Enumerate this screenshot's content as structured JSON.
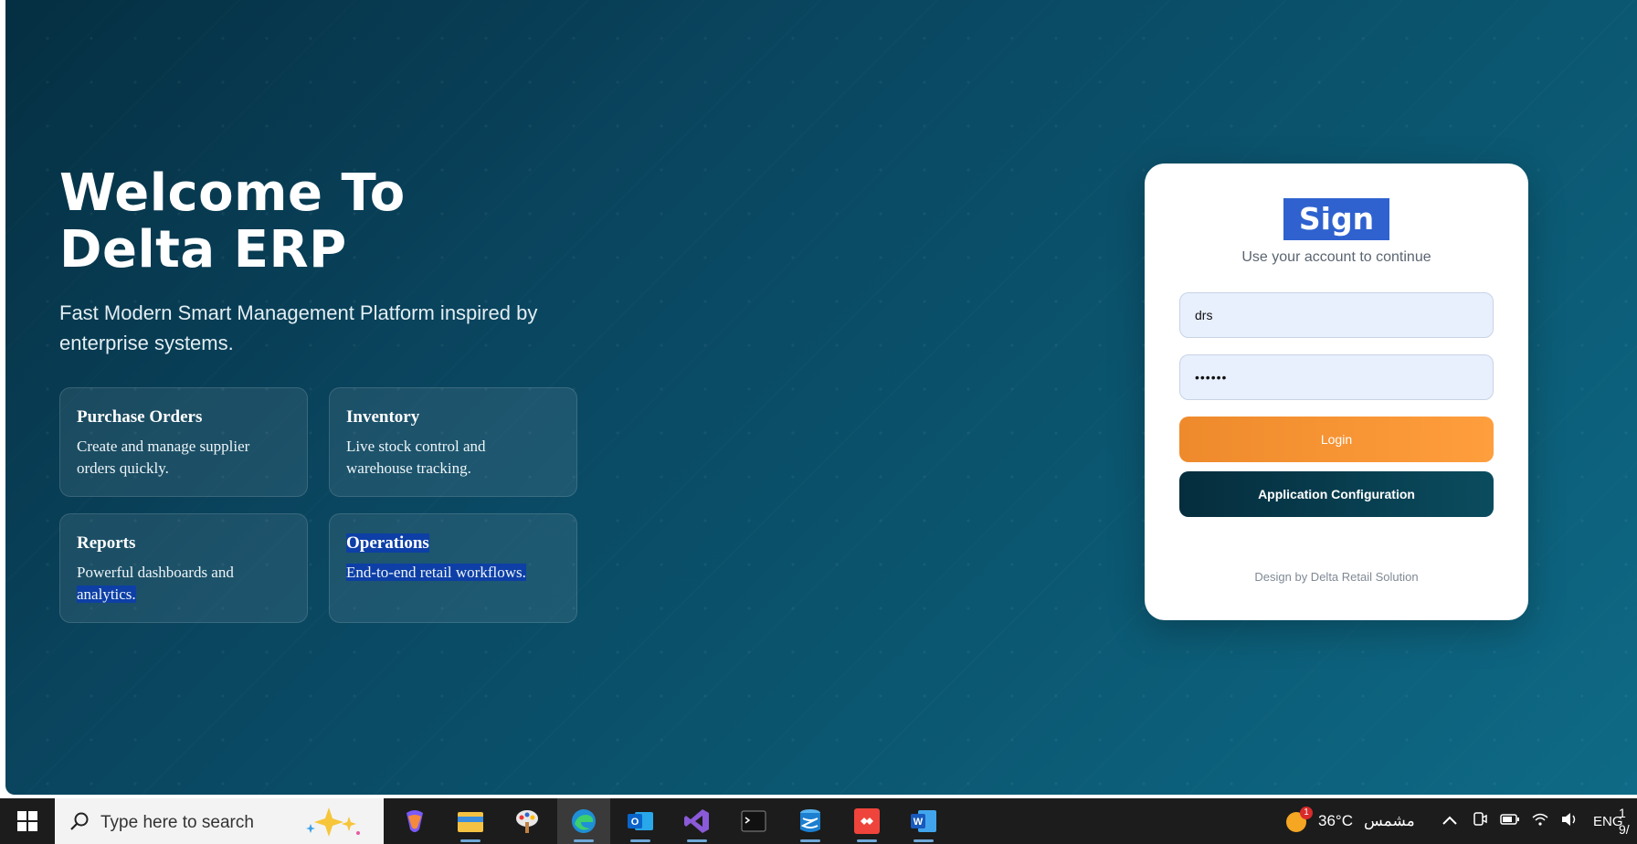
{
  "hero": {
    "title_line1": "Welcome To",
    "title_line2": "Delta ERP",
    "subtitle_line1": "Fast Modern Smart Management Platform inspired by",
    "subtitle_line2": "enterprise systems."
  },
  "features": [
    {
      "title": "Purchase Orders",
      "desc_line1": "Create and manage supplier",
      "desc_line2": "orders quickly."
    },
    {
      "title": "Inventory",
      "desc_line1": "Live stock control and",
      "desc_line2": "warehouse tracking."
    },
    {
      "title": "Reports",
      "desc_line1": "Powerful dashboards and",
      "desc_line2": "analytics."
    },
    {
      "title": "Operations",
      "desc_line1": "End-to-end retail workflows.",
      "desc_line2": ""
    }
  ],
  "login": {
    "title": "Sign In",
    "subtitle": "Use your account to continue",
    "username_value": "drs",
    "password_value": "••••••",
    "login_label": "Login",
    "config_label": "Application Configuration",
    "footer": "Design by Delta Retail Solution"
  },
  "taskbar": {
    "search_placeholder": "Type here to search",
    "weather_temp": "36°C",
    "weather_text": "مشمس",
    "weather_badge": "1",
    "language": "ENG",
    "clock_line1": "1",
    "clock_line2": "9/"
  },
  "colors": {
    "background_dark": "#052f42",
    "background_light": "#0e6a86",
    "login_button": "#f08c2e",
    "config_button": "#063545",
    "selection": "#0d3fa6"
  },
  "icons": [
    "windows-start-icon",
    "search-icon",
    "copilot-sparkle-icon",
    "copilot-app-icon",
    "file-explorer-icon",
    "paint-app-icon",
    "edge-browser-icon",
    "outlook-icon",
    "visual-studio-icon",
    "terminal-icon",
    "azure-data-studio-icon",
    "anydesk-icon",
    "word-icon",
    "weather-sun-icon",
    "chevron-up-icon",
    "meet-now-icon",
    "battery-icon",
    "wifi-icon",
    "speaker-icon"
  ]
}
